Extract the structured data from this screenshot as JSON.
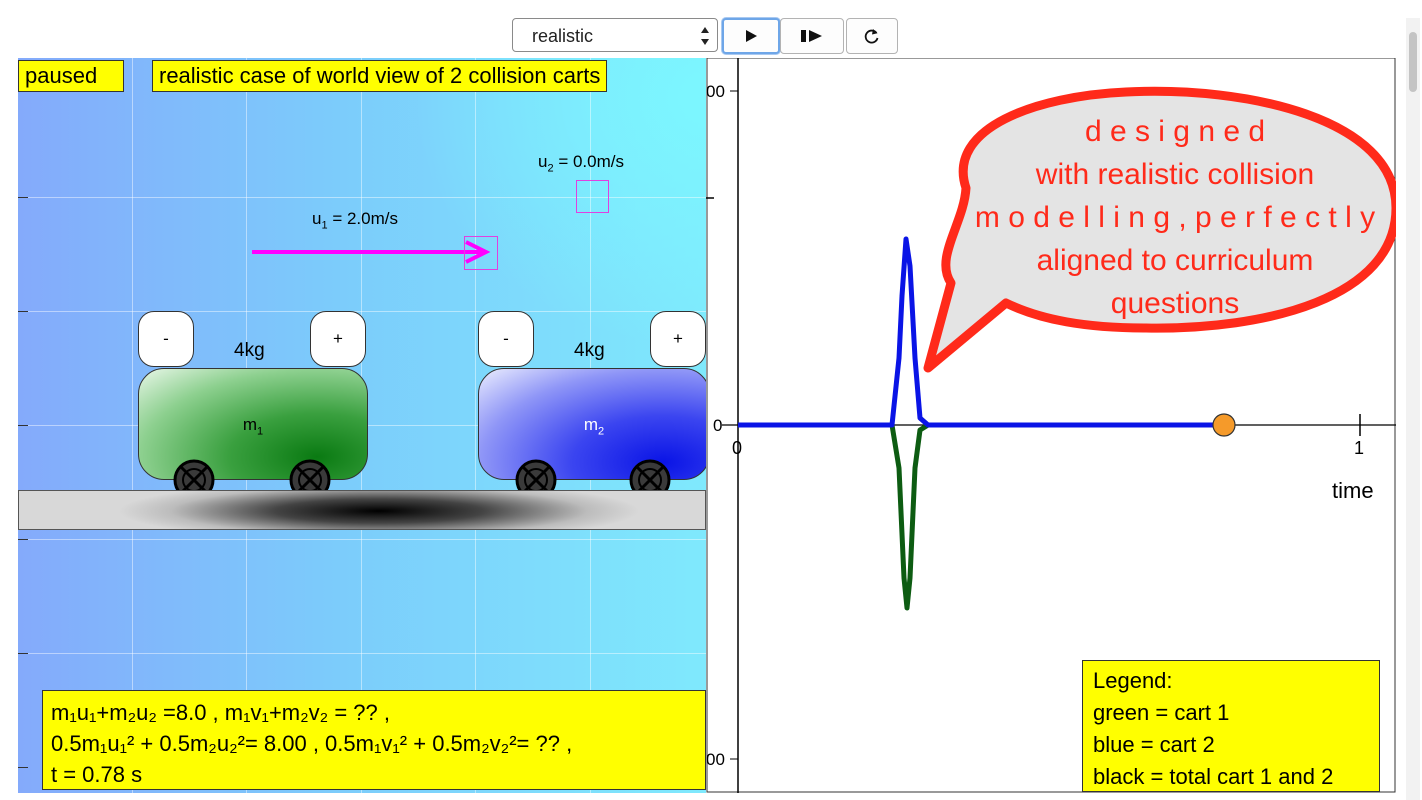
{
  "controls": {
    "mode_select_value": "realistic",
    "play_icon": "play-icon",
    "step_icon": "step-forward-icon",
    "reset_icon": "reset-icon"
  },
  "world": {
    "status": "paused",
    "title": "realistic case of world view of 2 collision carts",
    "u1_text": "= 2.0m/s",
    "u1_prefix": "u",
    "u1_sub": "1",
    "u2_text": "= 0.0m/s",
    "u2_prefix": "u",
    "u2_sub": "2",
    "cart1": {
      "mass": "4kg",
      "minus": "-",
      "plus": "+",
      "name": "m",
      "sub": "1",
      "color": "#0a7a12"
    },
    "cart2": {
      "mass": "4kg",
      "minus": "-",
      "plus": "+",
      "name": "m",
      "sub": "2",
      "color": "#0a14e6"
    },
    "equations": {
      "line1": "m₁u₁+m₂u₂ =8.0 , m₁v₁+m₂v₂ = ?? ,",
      "line2": " 0.5m₁u₁² + 0.5m₂u₂²= 8.00 , 0.5m₁v₁² + 0.5m₂v₂²= ?? ,",
      "line3": "t = 0.78 s"
    }
  },
  "graph": {
    "x_axis_label": "time",
    "tick_zero_x": "0",
    "tick_one_x": "1",
    "tick_zero_y": "0",
    "top_tick_label": "00",
    "bottom_tick_label": "00",
    "legend_title": "Legend:",
    "legend_green": "green = cart 1",
    "legend_blue": "blue = cart 2",
    "legend_black": "black = total cart 1 and 2",
    "colors": {
      "cart1": "#0d5c12",
      "cart2": "#0a14e6",
      "marker": "#f59a2a"
    }
  },
  "callout": {
    "line1": "d e s i g n e d",
    "line2": "with  realistic  collision",
    "line3": "m o d e l l i n g ,  p e r f e c t l y",
    "line4": "aligned  to  curriculum",
    "line5": "questions"
  }
}
